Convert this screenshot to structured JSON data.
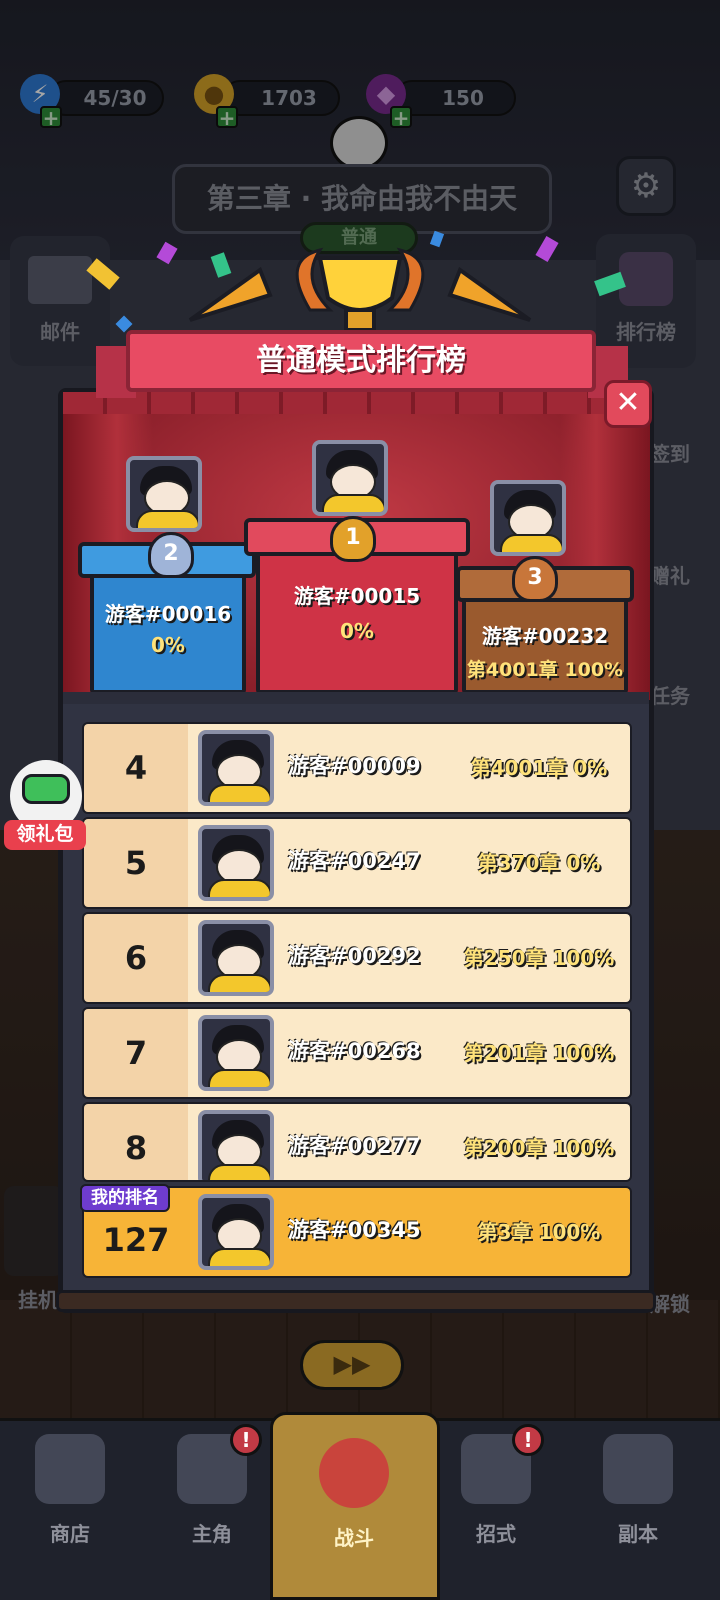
{
  "resources": {
    "energy": "45/30",
    "coins": "1703",
    "gems": "150"
  },
  "chapter": {
    "title": "第三章 · 我命由我不由天",
    "mode": "普通"
  },
  "side_left": {
    "mail": "邮件",
    "afk": "挂机"
  },
  "side_right": {
    "ranking": "排行榜",
    "checkin": "签到",
    "gift": "赠礼",
    "task": "任务",
    "locked": "解锁"
  },
  "leaderboard": {
    "title": "普通模式排行榜",
    "podium": [
      {
        "rank": "2",
        "name": "游客#00016",
        "score": "0%"
      },
      {
        "rank": "1",
        "name": "游客#00015",
        "score": "0%"
      },
      {
        "rank": "3",
        "name": "游客#00232",
        "score": "第4001章 100%"
      }
    ],
    "rows": [
      {
        "rank": "4",
        "name": "游客#00009",
        "score": "第4001章 0%"
      },
      {
        "rank": "5",
        "name": "游客#00247",
        "score": "第370章 0%"
      },
      {
        "rank": "6",
        "name": "游客#00292",
        "score": "第250章 100%"
      },
      {
        "rank": "7",
        "name": "游客#00268",
        "score": "第201章 100%"
      },
      {
        "rank": "8",
        "name": "游客#00277",
        "score": "第200章 100%"
      }
    ],
    "mine": {
      "tag": "我的排名",
      "rank": "127",
      "name": "游客#00345",
      "score": "第3章 100%"
    }
  },
  "gift_pack": "领礼包",
  "nav": [
    "商店",
    "主角",
    "战斗",
    "招式",
    "副本"
  ],
  "colors": {
    "accent_red": "#e84b63",
    "gold": "#f7b437",
    "row_bg": "#fbe9c8"
  }
}
